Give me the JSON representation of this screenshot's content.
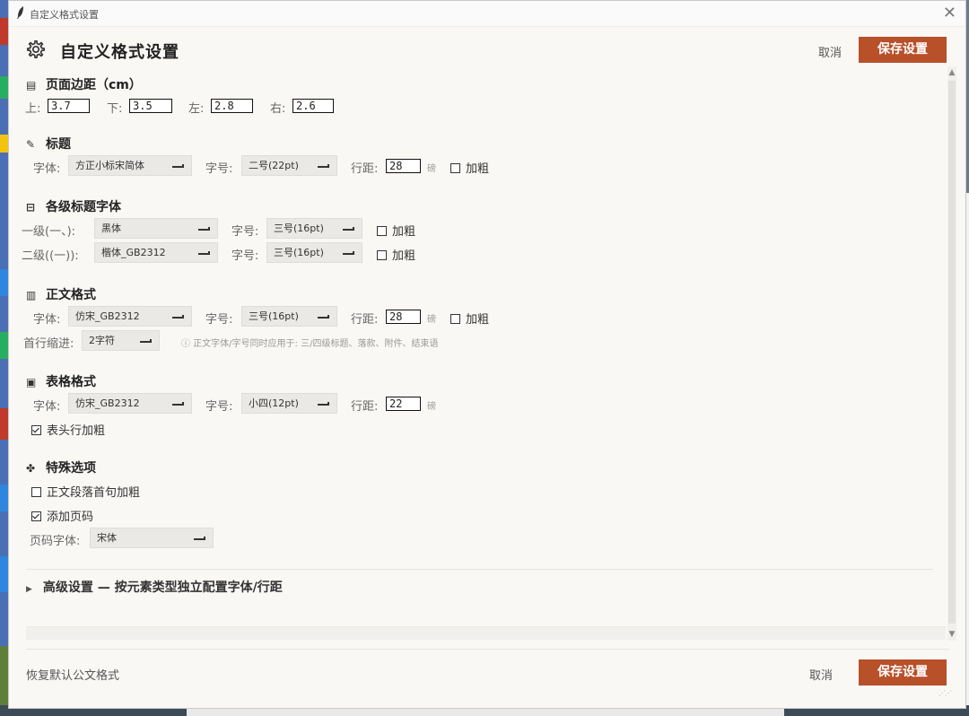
{
  "window": {
    "title": "自定义格式设置"
  },
  "header": {
    "title": "自定义格式设置",
    "cancel": "取消",
    "save": "保存设置"
  },
  "margins": {
    "title": "页面边距（cm）",
    "top_label": "上:",
    "top": "3.7",
    "bottom_label": "下:",
    "bottom": "3.5",
    "left_label": "左:",
    "left": "2.8",
    "right_label": "右:",
    "right": "2.6"
  },
  "title_section": {
    "title": "标题",
    "font_label": "字体:",
    "font": "方正小标宋简体",
    "size_label": "字号:",
    "size": "二号(22pt)",
    "spacing_label": "行距:",
    "spacing": "28",
    "unit": "磅",
    "bold_label": "加粗",
    "bold": false
  },
  "heading_fonts": {
    "title": "各级标题字体",
    "level1": {
      "label": "一级(一、):",
      "font": "黑体",
      "size_label": "字号:",
      "size": "三号(16pt)",
      "bold_label": "加粗",
      "bold": false
    },
    "level2": {
      "label": "二级((一)):",
      "font": "楷体_GB2312",
      "size_label": "字号:",
      "size": "三号(16pt)",
      "bold_label": "加粗",
      "bold": false
    }
  },
  "body_section": {
    "title": "正文格式",
    "font_label": "字体:",
    "font": "仿宋_GB2312",
    "size_label": "字号:",
    "size": "三号(16pt)",
    "spacing_label": "行距:",
    "spacing": "28",
    "unit": "磅",
    "bold_label": "加粗",
    "bold": false,
    "indent_label": "首行缩进:",
    "indent": "2字符",
    "hint": "ⓘ 正文字体/字号同时应用于: 三/四级标题、落款、附件、结束语"
  },
  "table_section": {
    "title": "表格格式",
    "font_label": "字体:",
    "font": "仿宋_GB2312",
    "size_label": "字号:",
    "size": "小四(12pt)",
    "spacing_label": "行距:",
    "spacing": "22",
    "unit": "磅",
    "header_bold_label": "表头行加粗",
    "header_bold": true
  },
  "special_section": {
    "title": "特殊选项",
    "first_sentence_bold_label": "正文段落首句加粗",
    "first_sentence_bold": false,
    "page_number_label": "添加页码",
    "page_number": true,
    "page_font_label": "页码字体:",
    "page_font": "宋体"
  },
  "advanced": {
    "label": "高级设置 — 按元素类型独立配置字体/行距"
  },
  "footer": {
    "restore": "恢复默认公文格式",
    "cancel": "取消",
    "save": "保存设置"
  },
  "colors": {
    "accent": "#b8502a",
    "background": "#faf8f5",
    "dropdown": "#ebe9e6"
  },
  "icons": {
    "settings": "gear-icon",
    "margins": "document-icon",
    "title": "edit-icon",
    "heading": "collapse-icon",
    "body": "book-icon",
    "table": "save-icon",
    "special": "puzzle-icon",
    "close": "close-icon",
    "app": "feather-icon"
  }
}
